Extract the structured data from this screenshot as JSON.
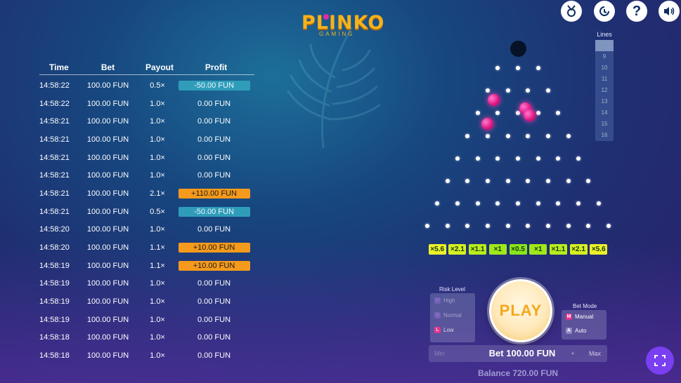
{
  "logo": {
    "text": "PLINKO",
    "sub": "GAMING"
  },
  "top_icons": [
    {
      "name": "achievements-icon",
      "glyph": "♗"
    },
    {
      "name": "history-icon",
      "glyph": "↻"
    },
    {
      "name": "help-icon",
      "glyph": "?"
    },
    {
      "name": "sound-icon",
      "glyph": "♪"
    }
  ],
  "history": {
    "headers": {
      "time": "Time",
      "bet": "Bet",
      "payout": "Payout",
      "profit": "Profit"
    },
    "rows": [
      {
        "time": "14:58:22",
        "bet": "100.00 FUN",
        "payout": "0.5×",
        "profit": "-50.00 FUN",
        "kind": "neg"
      },
      {
        "time": "14:58:22",
        "bet": "100.00 FUN",
        "payout": "1.0×",
        "profit": "0.00 FUN",
        "kind": "zero"
      },
      {
        "time": "14:58:21",
        "bet": "100.00 FUN",
        "payout": "1.0×",
        "profit": "0.00 FUN",
        "kind": "zero"
      },
      {
        "time": "14:58:21",
        "bet": "100.00 FUN",
        "payout": "1.0×",
        "profit": "0.00 FUN",
        "kind": "zero"
      },
      {
        "time": "14:58:21",
        "bet": "100.00 FUN",
        "payout": "1.0×",
        "profit": "0.00 FUN",
        "kind": "zero"
      },
      {
        "time": "14:58:21",
        "bet": "100.00 FUN",
        "payout": "1.0×",
        "profit": "0.00 FUN",
        "kind": "zero"
      },
      {
        "time": "14:58:21",
        "bet": "100.00 FUN",
        "payout": "2.1×",
        "profit": "+110.00 FUN",
        "kind": "pos"
      },
      {
        "time": "14:58:21",
        "bet": "100.00 FUN",
        "payout": "0.5×",
        "profit": "-50.00 FUN",
        "kind": "neg"
      },
      {
        "time": "14:58:20",
        "bet": "100.00 FUN",
        "payout": "1.0×",
        "profit": "0.00 FUN",
        "kind": "zero"
      },
      {
        "time": "14:58:20",
        "bet": "100.00 FUN",
        "payout": "1.1×",
        "profit": "+10.00 FUN",
        "kind": "pos"
      },
      {
        "time": "14:58:19",
        "bet": "100.00 FUN",
        "payout": "1.1×",
        "profit": "+10.00 FUN",
        "kind": "pos"
      },
      {
        "time": "14:58:19",
        "bet": "100.00 FUN",
        "payout": "1.0×",
        "profit": "0.00 FUN",
        "kind": "zero"
      },
      {
        "time": "14:58:19",
        "bet": "100.00 FUN",
        "payout": "1.0×",
        "profit": "0.00 FUN",
        "kind": "zero"
      },
      {
        "time": "14:58:19",
        "bet": "100.00 FUN",
        "payout": "1.0×",
        "profit": "0.00 FUN",
        "kind": "zero"
      },
      {
        "time": "14:58:18",
        "bet": "100.00 FUN",
        "payout": "1.0×",
        "profit": "0.00 FUN",
        "kind": "zero"
      },
      {
        "time": "14:58:18",
        "bet": "100.00 FUN",
        "payout": "1.0×",
        "profit": "0.00 FUN",
        "kind": "zero"
      }
    ]
  },
  "board": {
    "rows": 8,
    "multipliers": [
      "×5.6",
      "×2.1",
      "×1.1",
      "×1",
      "×0.5",
      "×1",
      "×1.1",
      "×2.1",
      "×5.6"
    ],
    "multiplier_colors": [
      "#ecf02a",
      "#d6ef22",
      "#b8ec1e",
      "#9fe81a",
      "#8ae41a",
      "#9fe81a",
      "#b8ec1e",
      "#d6ef22",
      "#ecf02a"
    ],
    "balls_in_play": 4
  },
  "lines": {
    "title": "Lines",
    "options": [
      "8",
      "9",
      "10",
      "11",
      "12",
      "13",
      "14",
      "15",
      "16"
    ],
    "selected": "8"
  },
  "risk": {
    "title": "Risk Level",
    "options": [
      {
        "label": "High",
        "badge": "H",
        "color": "#9e6fe0"
      },
      {
        "label": "Normal",
        "badge": "N",
        "color": "#9e6fe0"
      },
      {
        "label": "Low",
        "badge": "L",
        "color": "#e0358f"
      }
    ],
    "selected": "Low"
  },
  "play": {
    "label": "PLAY"
  },
  "bet_mode": {
    "title": "Bet Mode",
    "options": [
      {
        "label": "Manual",
        "badge": "M",
        "color": "#e0358f"
      },
      {
        "label": "Auto",
        "badge": "A",
        "color": "#8f86c8"
      }
    ],
    "selected": "Manual"
  },
  "bet": {
    "label": "Bet 100.00 FUN",
    "min": "Min",
    "plus": "+",
    "max": "Max"
  },
  "balance": {
    "label": "Balance 720.00 FUN"
  },
  "colors": {
    "accent": "#f4a81b",
    "negative": "#2f9db9",
    "positive": "#f59a1c",
    "ball": "#e0137f",
    "fullscreen": "#7b3ff2"
  }
}
